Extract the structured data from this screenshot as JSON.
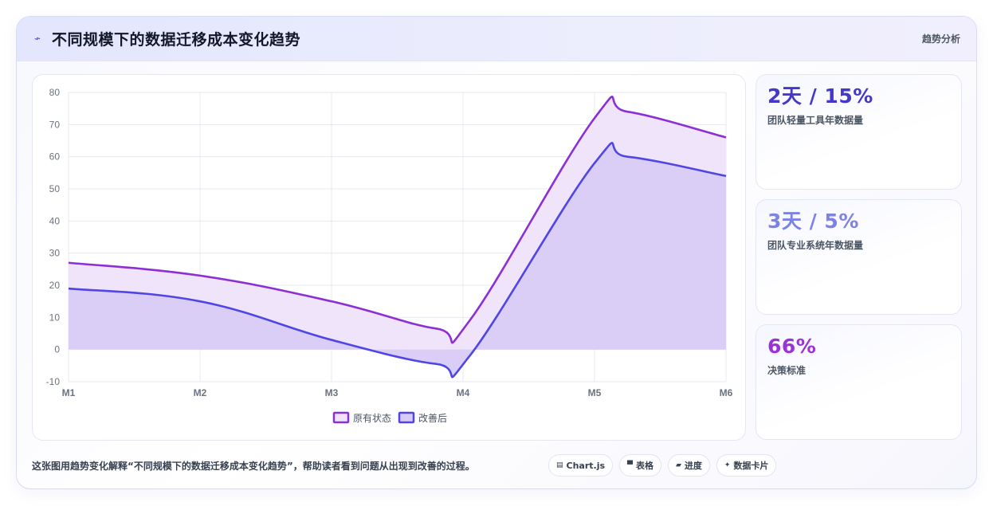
{
  "header": {
    "title": "不同规模下的数据迁移成本变化趋势",
    "tag": "趋势分析",
    "icon": "trend-line-icon"
  },
  "chart_data": {
    "type": "area",
    "categories": [
      "M1",
      "M2",
      "M3",
      "M4",
      "M5",
      "M6"
    ],
    "x_points": [
      0,
      1,
      2,
      2.8,
      3.05,
      4,
      4.25,
      5
    ],
    "series": [
      {
        "name": "原有状态",
        "color": "#8b2fd6",
        "fill": "#efe3fa",
        "values": [
          27,
          23,
          15,
          6.5,
          9,
          72,
          74,
          66
        ]
      },
      {
        "name": "改善后",
        "color": "#4f46e5",
        "fill": "#d8cbf5",
        "values": [
          19,
          15,
          3,
          -4.5,
          -2,
          58,
          60,
          54
        ]
      }
    ],
    "ylim": [
      -10,
      80
    ],
    "yticks": [
      -10,
      0,
      10,
      20,
      30,
      40,
      50,
      60,
      70,
      80
    ],
    "grid": true,
    "legend_position": "bottom"
  },
  "side_cards": [
    {
      "value": "2天 / 15%",
      "label": "团队轻量工具年数据量",
      "color": "#4338ca"
    },
    {
      "value": "3天 / 5%",
      "label": "团队专业系统年数据量",
      "color": "#7c83e6"
    },
    {
      "value": "66%",
      "label": "决策标准",
      "color": "#9b32d6"
    }
  ],
  "footer": {
    "caption": "这张图用趋势变化解释“不同规模下的数据迁移成本变化趋势”，帮助读者看到问题从出现到改善的过程。",
    "chips": [
      {
        "icon": "chart-icon",
        "glyph": "▤",
        "label": "Chart.js"
      },
      {
        "icon": "table-icon",
        "glyph": "▀",
        "label": "表格"
      },
      {
        "icon": "progress-icon",
        "glyph": "▰",
        "label": "进度"
      },
      {
        "icon": "sparkle-icon",
        "glyph": "✦",
        "label": "数据卡片"
      }
    ]
  }
}
